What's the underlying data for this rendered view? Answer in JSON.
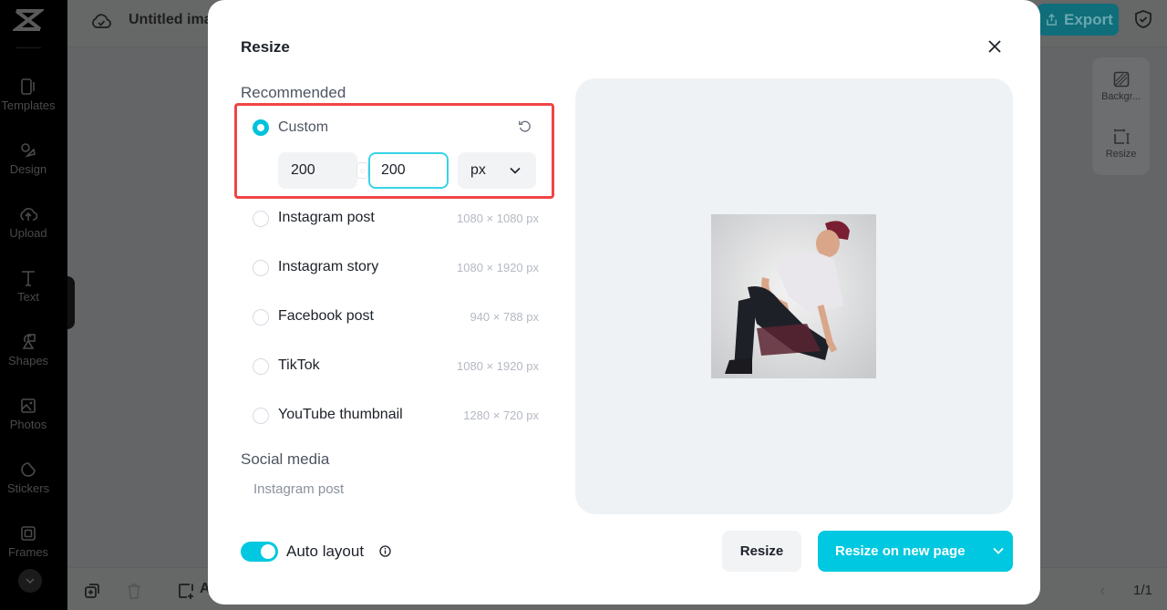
{
  "sidebar": {
    "logo": "capcut-logo",
    "items": [
      {
        "label": "Templates",
        "icon": "templates-icon"
      },
      {
        "label": "Design",
        "icon": "design-icon"
      },
      {
        "label": "Upload",
        "icon": "upload-icon"
      },
      {
        "label": "Text",
        "icon": "text-icon"
      },
      {
        "label": "Shapes",
        "icon": "shapes-icon"
      },
      {
        "label": "Photos",
        "icon": "photos-icon"
      },
      {
        "label": "Stickers",
        "icon": "stickers-icon"
      },
      {
        "label": "Frames",
        "icon": "frames-icon"
      }
    ]
  },
  "topbar": {
    "title": "Untitled ima",
    "export_label": "Export"
  },
  "right_tools": [
    {
      "label": "Backgr...",
      "icon": "background-icon"
    },
    {
      "label": "Resize",
      "icon": "resize-icon"
    }
  ],
  "bottombar": {
    "add_label": "A",
    "page_indicator": "1/1"
  },
  "modal": {
    "title": "Resize",
    "recommended_label": "Recommended",
    "custom": {
      "label": "Custom",
      "width": "200",
      "height": "200",
      "unit": "px",
      "selected": true
    },
    "options": [
      {
        "label": "Instagram post",
        "size": "1080 × 1080 px"
      },
      {
        "label": "Instagram story",
        "size": "1080 × 1920 px"
      },
      {
        "label": "Facebook post",
        "size": "940 × 788 px"
      },
      {
        "label": "TikTok",
        "size": "1080 × 1920 px"
      },
      {
        "label": "YouTube thumbnail",
        "size": "1280 × 720 px"
      }
    ],
    "social_media_label": "Social media",
    "social_media_items": [
      "Instagram post"
    ],
    "auto_layout_label": "Auto layout",
    "auto_layout_on": true,
    "resize_button": "Resize",
    "resize_new_page_button": "Resize on new page"
  },
  "colors": {
    "accent": "#00c8e0",
    "highlight_box": "#f04444"
  }
}
